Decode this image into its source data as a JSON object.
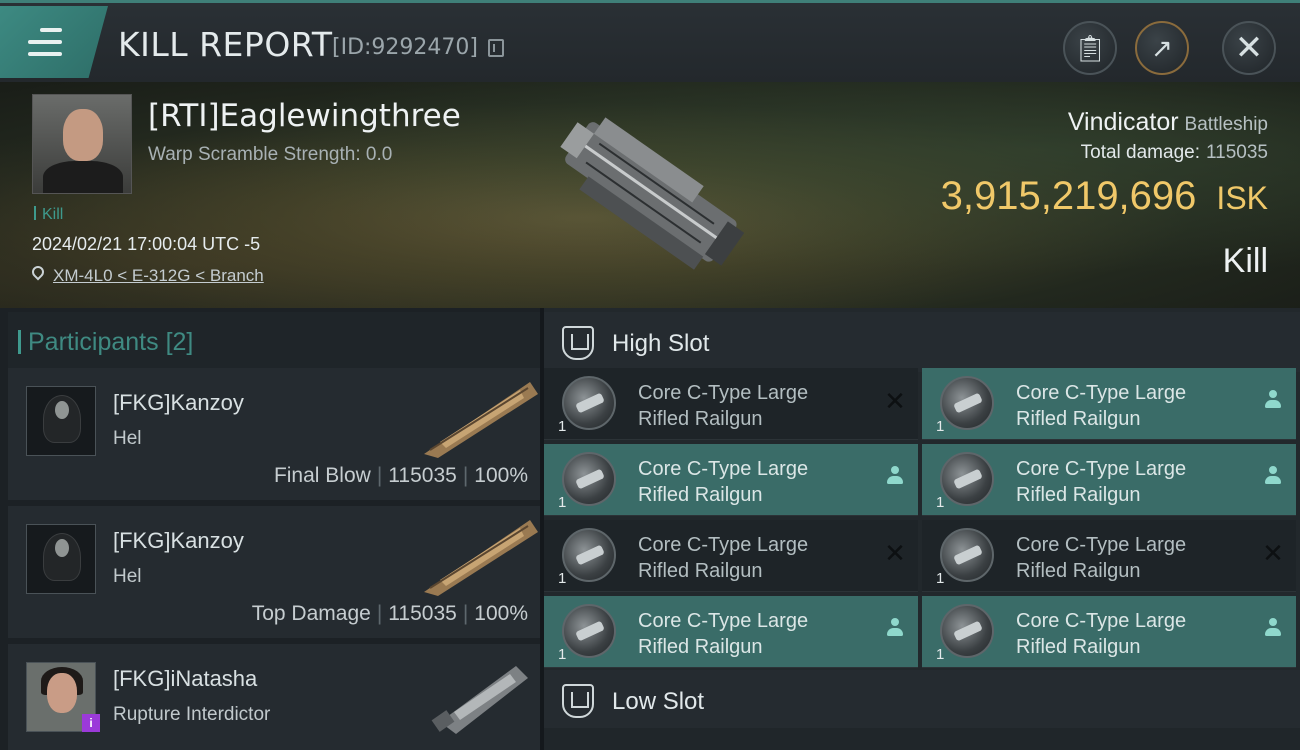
{
  "header": {
    "title": "KILL REPORT",
    "report_id": "[ID:9292470]"
  },
  "victim": {
    "name": "[RTI]Eaglewingthree",
    "warp_scramble": "Warp Scramble Strength: 0.0",
    "tag": "Kill",
    "datetime": "2024/02/21 17:00:04 UTC -5",
    "location": "XM-4L0 < E-312G < Branch",
    "ship": "Vindicator",
    "ship_class": "Battleship",
    "total_damage_label": "Total damage:",
    "total_damage": "115035",
    "isk_value": "3,915,219,696",
    "isk_unit": "ISK",
    "result": "Kill"
  },
  "participants": {
    "title": "Participants",
    "count": "[2]",
    "list": [
      {
        "name": "[FKG]Kanzoy",
        "ship": "Hel",
        "role": "Final Blow",
        "damage": "115035",
        "percent": "100%"
      },
      {
        "name": "[FKG]Kanzoy",
        "ship": "Hel",
        "role": "Top Damage",
        "damage": "115035",
        "percent": "100%"
      },
      {
        "name": "[FKG]iNatasha",
        "ship": "Rupture Interdictor",
        "badge": "i"
      }
    ]
  },
  "high_slot": {
    "title": "High Slot",
    "modules": [
      {
        "line1": "Core C-Type Large",
        "line2": "Rifled Railgun",
        "qty": "1",
        "status": "destroyed",
        "highlight": false
      },
      {
        "line1": "Core C-Type Large",
        "line2": "Rifled Railgun",
        "qty": "1",
        "status": "dropped",
        "highlight": true
      },
      {
        "line1": "Core C-Type Large",
        "line2": "Rifled Railgun",
        "qty": "1",
        "status": "dropped",
        "highlight": true
      },
      {
        "line1": "Core C-Type Large",
        "line2": "Rifled Railgun",
        "qty": "1",
        "status": "dropped",
        "highlight": true
      },
      {
        "line1": "Core C-Type Large",
        "line2": "Rifled Railgun",
        "qty": "1",
        "status": "destroyed",
        "highlight": false
      },
      {
        "line1": "Core C-Type Large",
        "line2": "Rifled Railgun",
        "qty": "1",
        "status": "destroyed",
        "highlight": false
      },
      {
        "line1": "Core C-Type Large",
        "line2": "Rifled Railgun",
        "qty": "1",
        "status": "dropped",
        "highlight": true
      },
      {
        "line1": "Core C-Type Large",
        "line2": "Rifled Railgun",
        "qty": "1",
        "status": "dropped",
        "highlight": true
      }
    ]
  },
  "low_slot": {
    "title": "Low Slot"
  },
  "icons": {
    "menu": "hamburger-icon",
    "copy": "copy-icon",
    "clipboard": "clipboard-icon",
    "share": "share-icon",
    "close": "close-icon",
    "location": "location-pin-icon"
  },
  "colors": {
    "accent": "#3f8a82",
    "isk": "#f0c869",
    "highlight_row": "#3a6c68"
  }
}
